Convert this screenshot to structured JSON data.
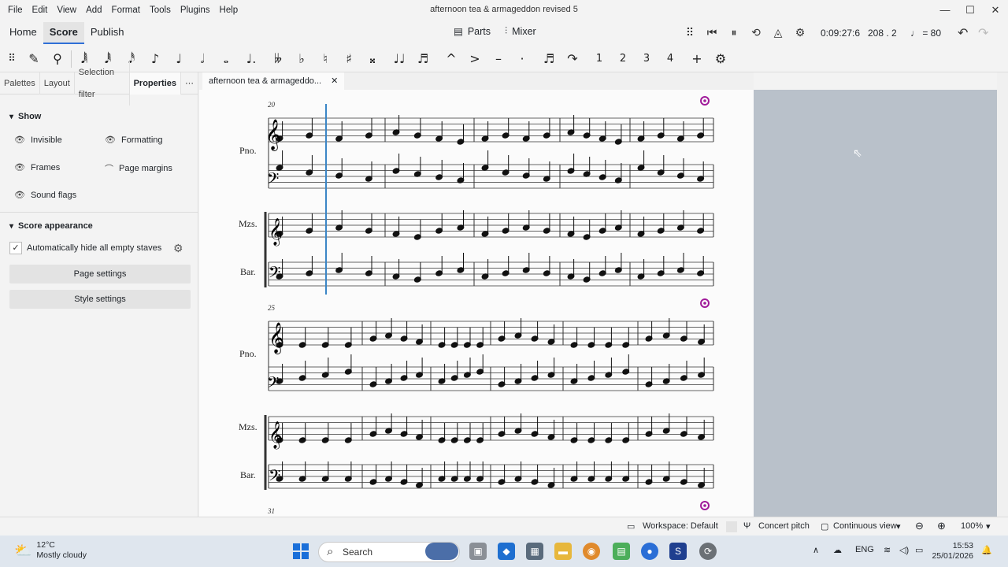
{
  "titlebar": {
    "menus": [
      "File",
      "Edit",
      "View",
      "Add",
      "Format",
      "Tools",
      "Plugins",
      "Help"
    ],
    "title": "afternoon tea & armageddon revised 5",
    "minimize": "—",
    "maximize": "☐",
    "close": "✕"
  },
  "modebar": {
    "tabs": [
      "Home",
      "Score",
      "Publish"
    ],
    "active_tab": "Score",
    "parts_label": "Parts",
    "mixer_label": "Mixer",
    "time": "0:09:27:6",
    "position": "208 . 2",
    "tempo": "= 80"
  },
  "notebar": {
    "tools": [
      "✎",
      "⚲",
      "𝅘𝅥𝅲",
      "𝅘𝅥𝅱",
      "𝅘𝅥𝅰",
      "♪",
      "♩",
      "𝅗𝅥",
      "𝅝",
      "♩.",
      "𝄫",
      "♭",
      "♮",
      "♯",
      "𝄪",
      "♩♩",
      "♬",
      "^",
      ">",
      "–",
      "·",
      "♬",
      "↷",
      "1",
      "2",
      "3",
      "4",
      "+",
      "⚙"
    ]
  },
  "leftpanel": {
    "tabs": [
      "Palettes",
      "Layout",
      "Selection filter",
      "Properties",
      "⋯"
    ],
    "active_tab": "Properties",
    "show_header": "Show",
    "show_items": [
      "Invisible",
      "Formatting",
      "Frames",
      "Page margins",
      "Sound flags"
    ],
    "appearance_header": "Score appearance",
    "hide_empty_label": "Automatically hide all empty staves",
    "page_settings": "Page settings",
    "style_settings": "Style settings"
  },
  "document": {
    "tab_title": "afternoon tea & armageddo...",
    "tab_close": "✕"
  },
  "score": {
    "system1": {
      "measure_number": "20",
      "labels": [
        "Pno.",
        "Mzs.",
        "Bar."
      ]
    },
    "system2": {
      "measure_number": "25",
      "labels": [
        "Pno.",
        "Mzs.",
        "Bar."
      ]
    },
    "system3": {
      "measure_number": "31"
    }
  },
  "statusbar": {
    "workspace": "Workspace: Default",
    "concert_pitch": "Concert pitch",
    "view_mode": "Continuous view",
    "zoom": "100%"
  },
  "taskbar": {
    "temperature": "12°C",
    "weather": "Mostly cloudy",
    "search_placeholder": "Search",
    "language": "ENG",
    "time": "15:53",
    "date": "25/01/2026"
  },
  "colors": {
    "accent": "#2f6fd6",
    "eye": "#a01a9a",
    "canvas_gray": "#b9c1ca"
  }
}
